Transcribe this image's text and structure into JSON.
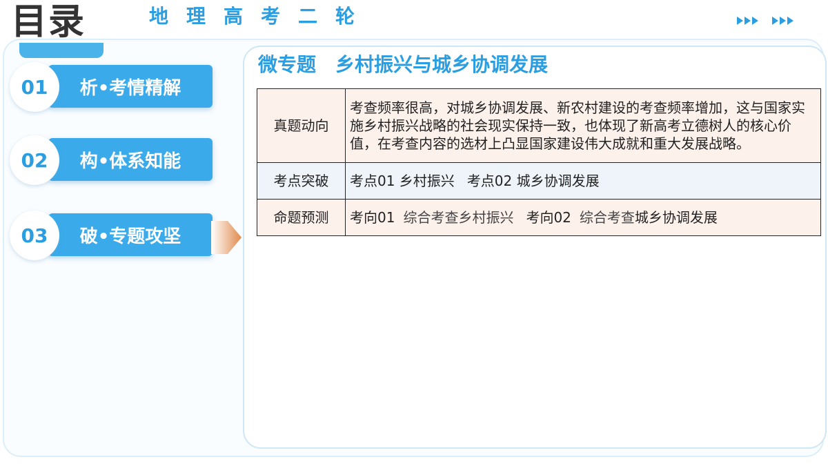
{
  "header": {
    "title": "目录",
    "subject": "地理高考二轮"
  },
  "nav": {
    "items": [
      {
        "num": "01",
        "label": "析•考情精解"
      },
      {
        "num": "02",
        "label": "构•体系知能"
      },
      {
        "num": "03",
        "label": "破•专题攻坚"
      }
    ]
  },
  "content": {
    "title_prefix": "微专题",
    "title_main": "乡村振兴与城乡协调发展",
    "table": {
      "row1": {
        "label": "真题动向",
        "text": "考查频率很高，对城乡协调发展、新农村建设的考查频率增加，这与国家实施乡村振兴战略的社会现实保持一致，也体现了新高考立德树人的核心价值，在考查内容的选材上凸显国家建设伟大成就和重大发展战略。"
      },
      "row2": {
        "label": "考点突破",
        "item1": "考点01 乡村振兴",
        "item2": "考点02 城乡协调发展"
      },
      "row3": {
        "label": "命题预测",
        "item1_code": "考向01",
        "item1_text": "综合考查乡村振兴",
        "item2_code": "考向02",
        "item2_text_a": "综合考查",
        "item2_text_b": "城乡协调发展"
      }
    }
  },
  "icons": {
    "top_right": "double-triple-arrow-icon",
    "pointer": "pointer-arrow-icon"
  },
  "colors": {
    "accent": "#2a9ee0",
    "pill": "#3aaaea",
    "pointer": "#e08a4e"
  }
}
